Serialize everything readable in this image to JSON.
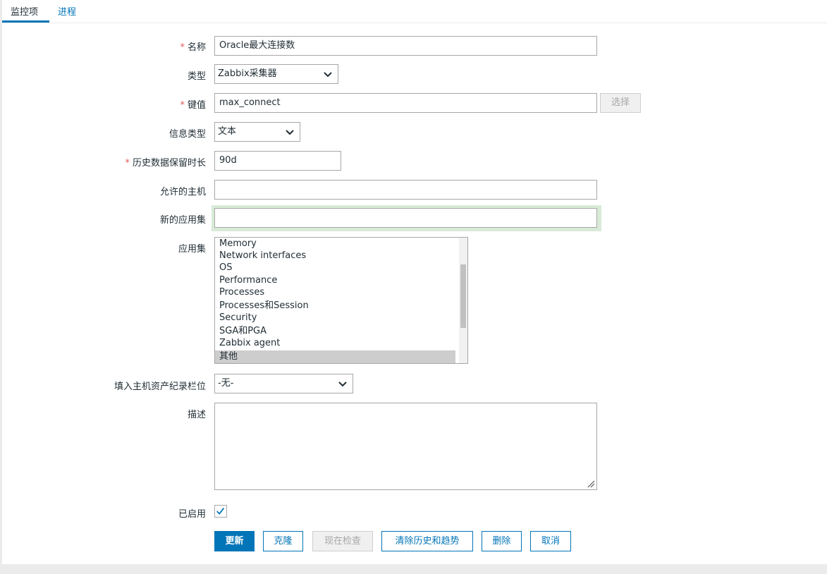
{
  "tabs": [
    {
      "label": "监控项",
      "active": true
    },
    {
      "label": "进程",
      "active": false
    }
  ],
  "form": {
    "name": {
      "label": "名称",
      "required": true,
      "value": "Oracle最大连接数"
    },
    "type": {
      "label": "类型",
      "value": "Zabbix采集器"
    },
    "key": {
      "label": "键值",
      "required": true,
      "value": "max_connect",
      "select_button": "选择"
    },
    "value_type": {
      "label": "信息类型",
      "value": "文本"
    },
    "history": {
      "label": "历史数据保留时长",
      "required": true,
      "value": "90d"
    },
    "allowed_hosts": {
      "label": "允许的主机",
      "value": ""
    },
    "new_application": {
      "label": "新的应用集",
      "value": ""
    },
    "applications": {
      "label": "应用集",
      "items": [
        "Memory",
        "Network interfaces",
        "OS",
        "Performance",
        "Processes",
        "Processes和Session",
        "Security",
        "SGA和PGA",
        "Zabbix agent",
        "其他"
      ],
      "selected": "其他"
    },
    "inventory_link": {
      "label": "填入主机资产纪录栏位",
      "value": "-无-"
    },
    "description": {
      "label": "描述",
      "value": ""
    },
    "enabled": {
      "label": "已启用",
      "checked": true
    }
  },
  "buttons": {
    "update": "更新",
    "clone": "克隆",
    "check_now": "现在检查",
    "clear_history": "清除历史和趋势",
    "delete": "删除",
    "cancel": "取消"
  },
  "colors": {
    "accent": "#0275b8",
    "required": "#e45959",
    "focus_glow": "#d9ebd8"
  }
}
